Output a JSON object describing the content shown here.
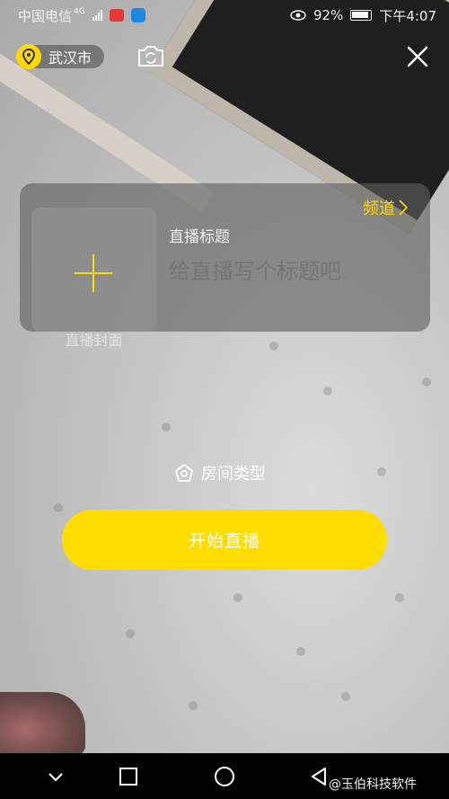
{
  "status_bar": {
    "carrier": "中国电信",
    "network": "4G",
    "battery": "92%",
    "time": "下午4:07"
  },
  "location": {
    "city": "武汉市"
  },
  "icons": {
    "location": "location-pin-icon",
    "camera_switch": "camera-switch-icon",
    "close": "close-icon",
    "add_cover": "plus-icon",
    "channel": "chevron-right-icon",
    "room_type": "home-icon"
  },
  "card": {
    "cover_label": "直播封面",
    "title_label": "直播标题",
    "title_placeholder": "给直播写个标题吧",
    "channel_label": "频道"
  },
  "room_type": {
    "label": "房间类型"
  },
  "start_button": {
    "label": "开始直播"
  },
  "watermark": "@玉伯科技软件",
  "colors": {
    "accent": "#ffdd00"
  }
}
